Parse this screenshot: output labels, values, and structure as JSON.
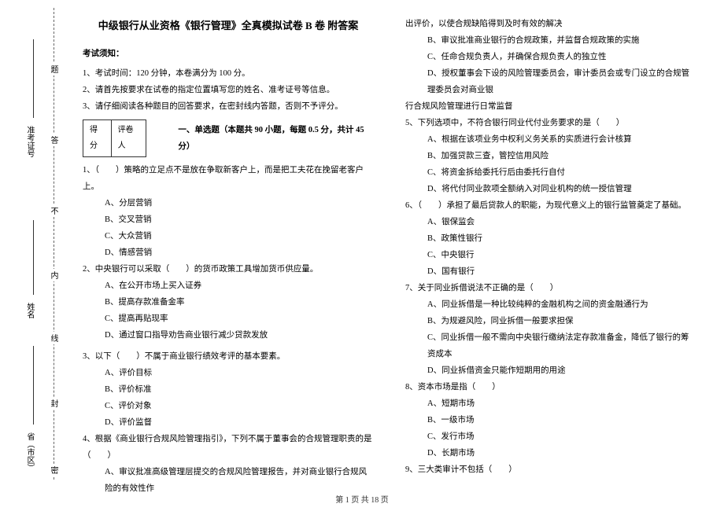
{
  "binding": {
    "labels": [
      "省（市区）",
      "姓名",
      "准考证号"
    ],
    "seal_chars": [
      "密",
      "封",
      "线",
      "内",
      "不",
      "答",
      "题"
    ]
  },
  "header": {
    "title": "中级银行从业资格《银行管理》全真模拟试卷 B 卷  附答案"
  },
  "instructions": {
    "heading": "考试须知：",
    "items": [
      "1、考试时间：120 分钟，本卷满分为 100 分。",
      "2、请首先按要求在试卷的指定位置填写您的姓名、准考证号等信息。",
      "3、请仔细阅读各种题目的回答要求，在密封线内答题，否则不予评分。"
    ]
  },
  "score_box": {
    "score": "得分",
    "grader": "评卷人"
  },
  "section1": {
    "title": "一、单选题（本题共 90 小题，每题 0.5 分，共计 45 分）"
  },
  "q1": {
    "stem": "1、（　　）策略的立足点不是放在争取新客户上，而是把工夫花在挽留老客户上。",
    "A": "A、分层营销",
    "B": "B、交叉营销",
    "C": "C、大众营销",
    "D": "D、情感营销"
  },
  "q2": {
    "stem": "2、中央银行可以采取（　　）的货币政策工具增加货币供应量。",
    "A": "A、在公开市场上买入证券",
    "B": "B、提高存款准备金率",
    "C": "C、提高再贴现率",
    "D": "D、通过窗口指导劝告商业银行减少贷款发放"
  },
  "q3": {
    "stem": "3、以下（　　）不属于商业银行绩效考评的基本要素。",
    "A": "A、评价目标",
    "B": "B、评价标准",
    "C": "C、评价对象",
    "D": "D、评价监督"
  },
  "q4": {
    "stem": "4、根据《商业银行合规风险管理指引》，下列不属于董事会的合规管理职责的是（　　）",
    "A": "A、审议批准高级管理层提交的合规风险管理报告，并对商业银行合规风险的有效性作"
  },
  "q4_cont": {
    "tail": "出评价，以使合规缺陷得到及时有效的解决",
    "B": "B、审议批准商业银行的合规政策，并监督合规政策的实施",
    "C": "C、任命合规负责人，并确保合规负责人的独立性",
    "D": "D、授权董事会下设的风险管理委员会，审计委员会或专门设立的合规管理委员会对商业银"
  },
  "q4_cont2": "行合规风险管理进行日常监督",
  "q5": {
    "stem": "5、下列选项中，不符合银行同业代付业务要求的是（　　）",
    "A": "A、根据在该项业务中权利义务关系的实质进行会计核算",
    "B": "B、加强贷款三查，管控信用风险",
    "C": "C、将资金拆给委托行后由委托行自付",
    "D": "D、将代付同业款项全额纳入对同业机构的统一授信管理"
  },
  "q6": {
    "stem": "6、（　　）承担了最后贷款人的职能，为现代意义上的银行监管奠定了基础。",
    "A": "A、银保监会",
    "B": "B、政策性银行",
    "C": "C、中央银行",
    "D": "D、国有银行"
  },
  "q7": {
    "stem": "7、关于同业拆借说法不正确的是（　　）",
    "A": "A、同业拆借是一种比较纯粹的金融机构之间的资金融通行为",
    "B": "B、为规避风险，同业拆借一般要求担保",
    "C": "C、同业拆借一般不需向中央银行缴纳法定存款准备金，降低了银行的筹资成本",
    "D": "D、同业拆借资金只能作短期用的用途"
  },
  "q8": {
    "stem": "8、资本市场是指（　　）",
    "A": "A、短期市场",
    "B": "B、一级市场",
    "C": "C、发行市场",
    "D": "D、长期市场"
  },
  "q9": {
    "stem": "9、三大类审计不包括（　　）"
  },
  "footer": "第 1 页  共 18 页"
}
